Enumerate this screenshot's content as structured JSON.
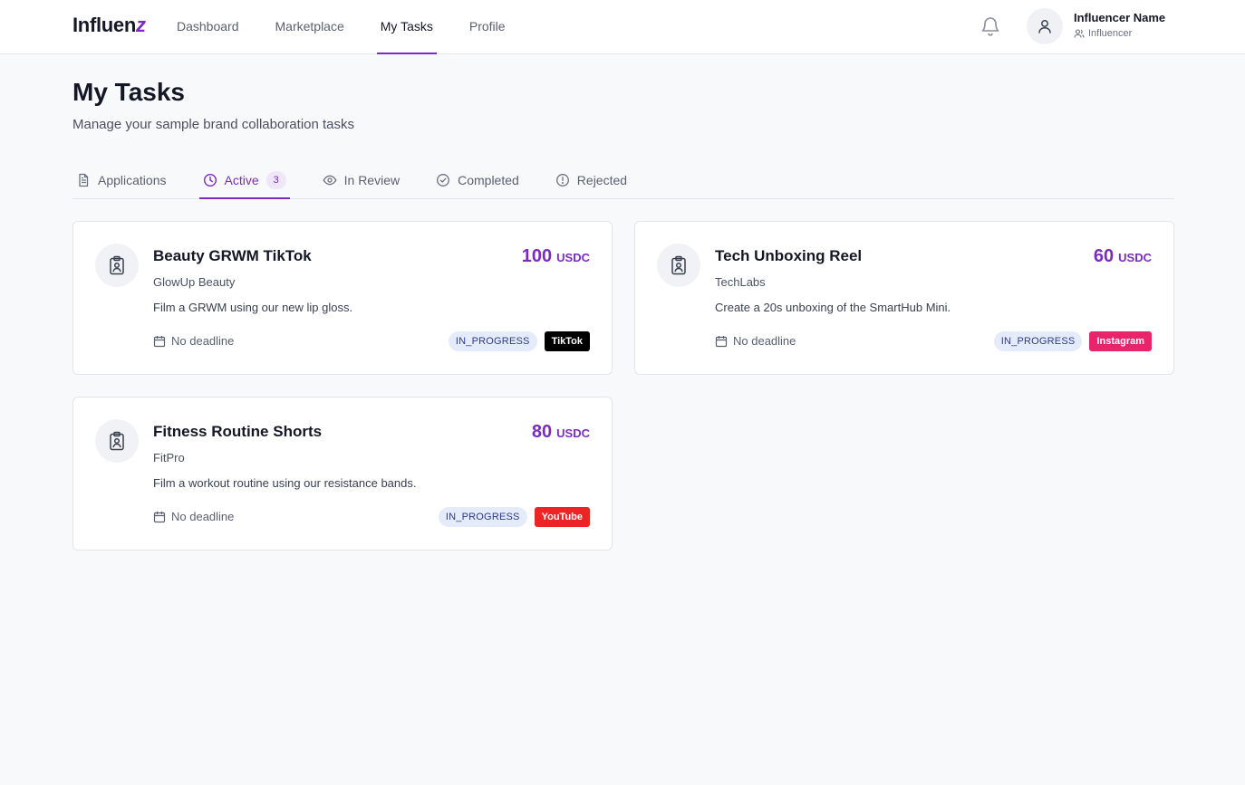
{
  "app": {
    "logo_main": "Influen",
    "logo_accent": "z"
  },
  "nav": {
    "items": [
      {
        "label": "Dashboard"
      },
      {
        "label": "Marketplace"
      },
      {
        "label": "My Tasks",
        "active": true
      },
      {
        "label": "Profile"
      }
    ]
  },
  "user": {
    "name": "Influencer Name",
    "role": "Influencer",
    "avatar_icon": "user-icon",
    "notification_icon": "bell-icon"
  },
  "page": {
    "title": "My Tasks",
    "subtitle": "Manage your sample brand collaboration tasks"
  },
  "tabs": [
    {
      "label": "Applications",
      "icon": "file-text-icon"
    },
    {
      "label": "Active",
      "icon": "clock-icon",
      "count": "3",
      "active": true
    },
    {
      "label": "In Review",
      "icon": "eye-icon"
    },
    {
      "label": "Completed",
      "icon": "check-circle-icon"
    },
    {
      "label": "Rejected",
      "icon": "alert-circle-icon"
    }
  ],
  "tasks": [
    {
      "title": "Beauty GRWM TikTok",
      "brand": "GlowUp Beauty",
      "description": "Film a GRWM using our new lip gloss.",
      "amount": "100",
      "currency": "USDC",
      "deadline": "No deadline",
      "status": "IN_PROGRESS",
      "platform": "TikTok",
      "platform_color": "#000000"
    },
    {
      "title": "Tech Unboxing Reel",
      "brand": "TechLabs",
      "description": "Create a 20s unboxing of the SmartHub Mini.",
      "amount": "60",
      "currency": "USDC",
      "deadline": "No deadline",
      "status": "IN_PROGRESS",
      "platform": "Instagram",
      "platform_color": "#e6256a"
    },
    {
      "title": "Fitness Routine Shorts",
      "brand": "FitPro",
      "description": "Film a workout routine using our resistance bands.",
      "amount": "80",
      "currency": "USDC",
      "deadline": "No deadline",
      "status": "IN_PROGRESS",
      "platform": "YouTube",
      "platform_color": "#ee2424"
    }
  ],
  "colors": {
    "accent": "#7b2cbf",
    "status_bg": "#e4ebfa",
    "status_text": "#2d3a8c"
  }
}
